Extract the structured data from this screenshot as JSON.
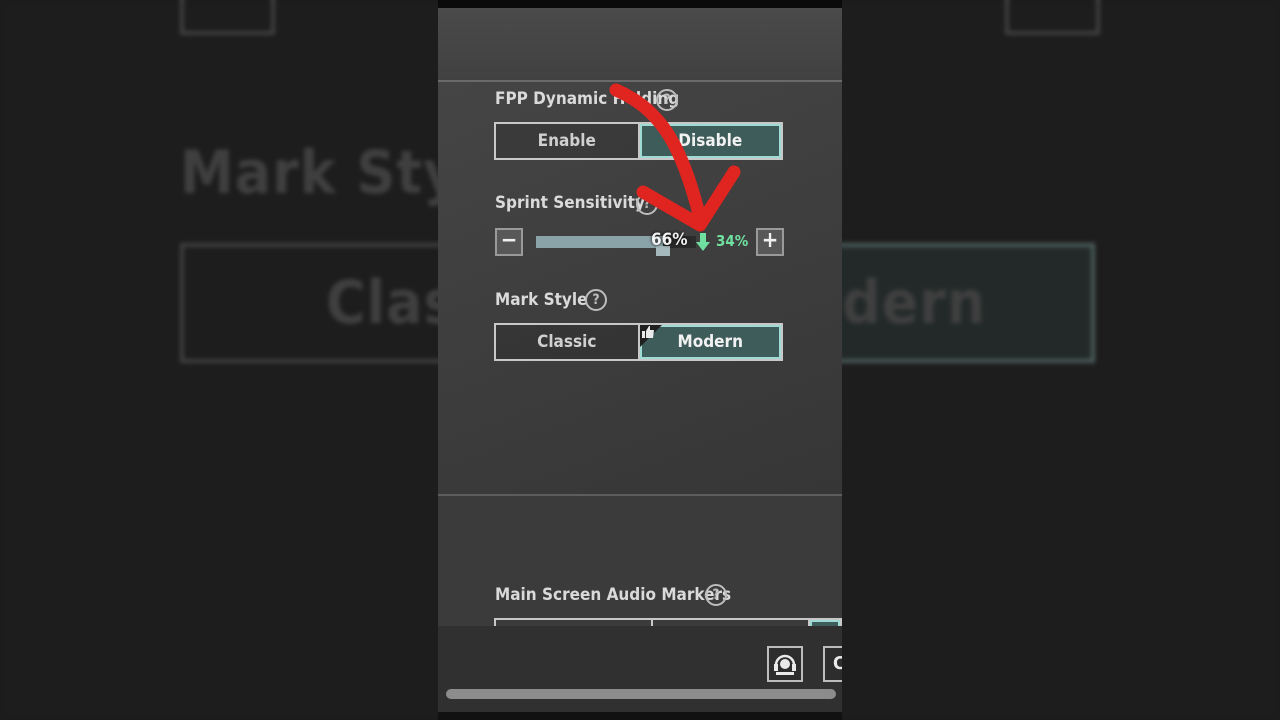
{
  "background": {
    "mark_style_title": "Mark Style",
    "classic_fragment": "Class",
    "modern_fragment": "dern"
  },
  "settings": {
    "fpp_dynamic_holding": {
      "label": "FPP Dynamic Holding",
      "help": "?",
      "options": [
        "Enable",
        "Disable"
      ],
      "selected": "Disable"
    },
    "sprint_sensitivity": {
      "label": "Sprint Sensitivity",
      "help": "?",
      "value_text": "66%",
      "value": 66,
      "change_text": "34%",
      "decrease": "−",
      "increase": "+"
    },
    "mark_style": {
      "label": "Mark Style",
      "help": "?",
      "options": [
        "Classic",
        "Modern"
      ],
      "selected": "Modern"
    },
    "main_screen_audio_markers": {
      "label": "Main Screen Audio Markers",
      "help": "?"
    }
  },
  "footer": {
    "partial_button_text": "C"
  },
  "colors": {
    "accent": "#3e5c5a",
    "accent_border": "#9fdad4",
    "annotation_arrow": "#e0241f",
    "change_indicator": "#6fe0a0"
  },
  "icons": {
    "help": "question-circle-icon",
    "recommend": "thumbs-up-icon",
    "annotation": "red-arrow-annotation",
    "change": "down-arrow-icon",
    "headset": "headset-icon"
  }
}
